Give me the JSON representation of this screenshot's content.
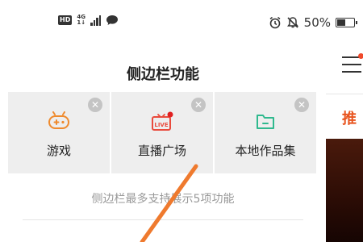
{
  "status_bar": {
    "hd": "HD",
    "network_gen": "4G",
    "network_sub": "1↓",
    "battery_percent": "50%",
    "battery_level": 0.5,
    "icons": [
      "hd-icon",
      "signal-icon",
      "message-icon",
      "alarm-icon",
      "mute-icon",
      "battery-icon"
    ]
  },
  "sheet": {
    "title": "侧边栏功能",
    "items": [
      {
        "label": "游戏",
        "icon": "gamepad-icon",
        "color": "#ef8a2d"
      },
      {
        "label": "直播广场",
        "icon": "live-icon",
        "color": "#e94a3c",
        "badge_color": "#e02020"
      },
      {
        "label": "本地作品集",
        "icon": "folder-icon",
        "color": "#2fb98e"
      }
    ],
    "hint": "侧边栏最多支持展示5项功能"
  },
  "peek": {
    "tab_text": "推",
    "accent": "#e8541e"
  },
  "gesture_color": "#ef7a2e"
}
